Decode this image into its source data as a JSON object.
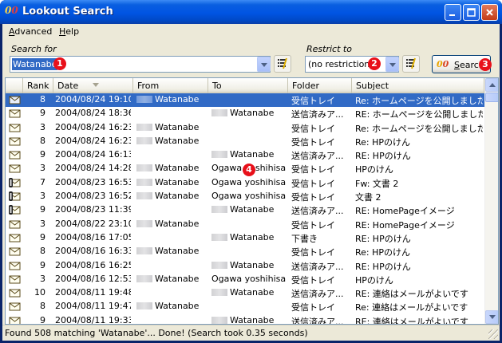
{
  "window": {
    "title": "Lookout Search"
  },
  "menu": {
    "advanced_prefix": "",
    "advanced_u": "A",
    "advanced_rest": "dvanced",
    "help_u": "H",
    "help_rest": "elp"
  },
  "search": {
    "label": "Search for",
    "value": "Watanabe",
    "restrict_label": "Restrict to",
    "restrict_value": "(no restriction)",
    "button_logo": "00",
    "button_prefix": "",
    "button_u": "S",
    "button_rest": "earch"
  },
  "badges": [
    "1",
    "2",
    "3",
    "4"
  ],
  "columns": {
    "rank": "Rank",
    "date": "Date",
    "from": "From",
    "to": "To",
    "folder": "Folder",
    "subject": "Subject"
  },
  "rows": [
    {
      "rank": "8",
      "date": "2004/08/24 19:10",
      "from": "Watanabe",
      "to": "",
      "folder": "受信トレイ",
      "subject": "Re: ホームページを公開しました",
      "icon": "envelope-open-icon",
      "fromRedacted": true,
      "toRedacted": false,
      "selected": true
    },
    {
      "rank": "9",
      "date": "2004/08/24 18:36",
      "from": "",
      "to": "Watanabe",
      "folder": "送信済みア...",
      "subject": "RE: ホームページを公開しました",
      "icon": "envelope-icon",
      "fromRedacted": false,
      "toRedacted": true
    },
    {
      "rank": "3",
      "date": "2004/08/24 16:23",
      "from": "Watanabe",
      "to": "",
      "folder": "受信トレイ",
      "subject": "Re: ホームページを公開しました",
      "icon": "envelope-icon",
      "fromRedacted": true,
      "toRedacted": false
    },
    {
      "rank": "8",
      "date": "2004/08/24 16:23",
      "from": "Watanabe",
      "to": "",
      "folder": "受信トレイ",
      "subject": "Re: HPのけん",
      "icon": "envelope-icon",
      "fromRedacted": true,
      "toRedacted": false
    },
    {
      "rank": "9",
      "date": "2004/08/24 16:13",
      "from": "",
      "to": "Watanabe",
      "folder": "送信済みア...",
      "subject": "RE: HPのけん",
      "icon": "envelope-icon",
      "fromRedacted": false,
      "toRedacted": true
    },
    {
      "rank": "3",
      "date": "2004/08/24 14:28",
      "from": "Watanabe",
      "to": "Ogawa yoshihisa",
      "folder": "受信トレイ",
      "subject": "HPのけん",
      "icon": "envelope-icon",
      "fromRedacted": true,
      "toRedacted": false
    },
    {
      "rank": "7",
      "date": "2004/08/23 16:53",
      "from": "Watanabe",
      "to": "Ogawa yoshihisa",
      "folder": "受信トレイ",
      "subject": "Fw: 文書 2",
      "icon": "envelope-attachment-icon",
      "fromRedacted": true,
      "toRedacted": false
    },
    {
      "rank": "3",
      "date": "2004/08/23 16:52",
      "from": "Watanabe",
      "to": "Ogawa yoshihisa",
      "folder": "受信トレイ",
      "subject": "文書 2",
      "icon": "envelope-attachment-icon",
      "fromRedacted": true,
      "toRedacted": false
    },
    {
      "rank": "9",
      "date": "2004/08/23 11:39",
      "from": "",
      "to": "Watanabe",
      "folder": "送信済みア...",
      "subject": "RE: HomePageイメージ",
      "icon": "envelope-attachment-icon",
      "fromRedacted": false,
      "toRedacted": true
    },
    {
      "rank": "3",
      "date": "2004/08/22 23:10",
      "from": "Watanabe",
      "to": "",
      "folder": "受信トレイ",
      "subject": "RE: HomePageイメージ",
      "icon": "envelope-icon",
      "fromRedacted": true,
      "toRedacted": false
    },
    {
      "rank": "9",
      "date": "2004/08/16 17:05",
      "from": "",
      "to": "Watanabe",
      "folder": "下書き",
      "subject": "RE: HPのけん",
      "icon": "envelope-icon",
      "fromRedacted": false,
      "toRedacted": true
    },
    {
      "rank": "8",
      "date": "2004/08/16 16:33",
      "from": "Watanabe",
      "to": "",
      "folder": "受信トレイ",
      "subject": "Re: HPのけん",
      "icon": "envelope-icon",
      "fromRedacted": true,
      "toRedacted": false
    },
    {
      "rank": "9",
      "date": "2004/08/16 16:25",
      "from": "",
      "to": "Watanabe",
      "folder": "送信済みア...",
      "subject": "RE: HPのけん",
      "icon": "envelope-icon",
      "fromRedacted": false,
      "toRedacted": true
    },
    {
      "rank": "3",
      "date": "2004/08/16 12:53",
      "from": "Watanabe",
      "to": "Ogawa yoshihisa",
      "folder": "受信トレイ",
      "subject": "HPのけん",
      "icon": "envelope-icon",
      "fromRedacted": true,
      "toRedacted": false
    },
    {
      "rank": "10",
      "date": "2004/08/11 19:48",
      "from": "",
      "to": "Watanabe",
      "folder": "送信済みア...",
      "subject": "RE: 連絡はメールがよいです",
      "icon": "envelope-icon",
      "fromRedacted": false,
      "toRedacted": true
    },
    {
      "rank": "8",
      "date": "2004/08/11 19:47",
      "from": "Watanabe",
      "to": "",
      "folder": "受信トレイ",
      "subject": "Re: 連絡はメールがよいです",
      "icon": "envelope-icon",
      "fromRedacted": true,
      "toRedacted": false
    },
    {
      "rank": "9",
      "date": "2004/08/11 19:33",
      "from": "",
      "to": "Watanabe",
      "folder": "送信済みア...",
      "subject": "RE: 連絡はメールがよいです",
      "icon": "envelope-icon",
      "fromRedacted": false,
      "toRedacted": true
    }
  ],
  "status": {
    "text": "Found 508 matching 'Watanabe'... Done! (Search took 0.35 seconds)"
  },
  "colors": {
    "title_bar": "#0054e3",
    "selection": "#316ac5",
    "badge": "#e8101a",
    "window_face": "#ece9d8"
  }
}
